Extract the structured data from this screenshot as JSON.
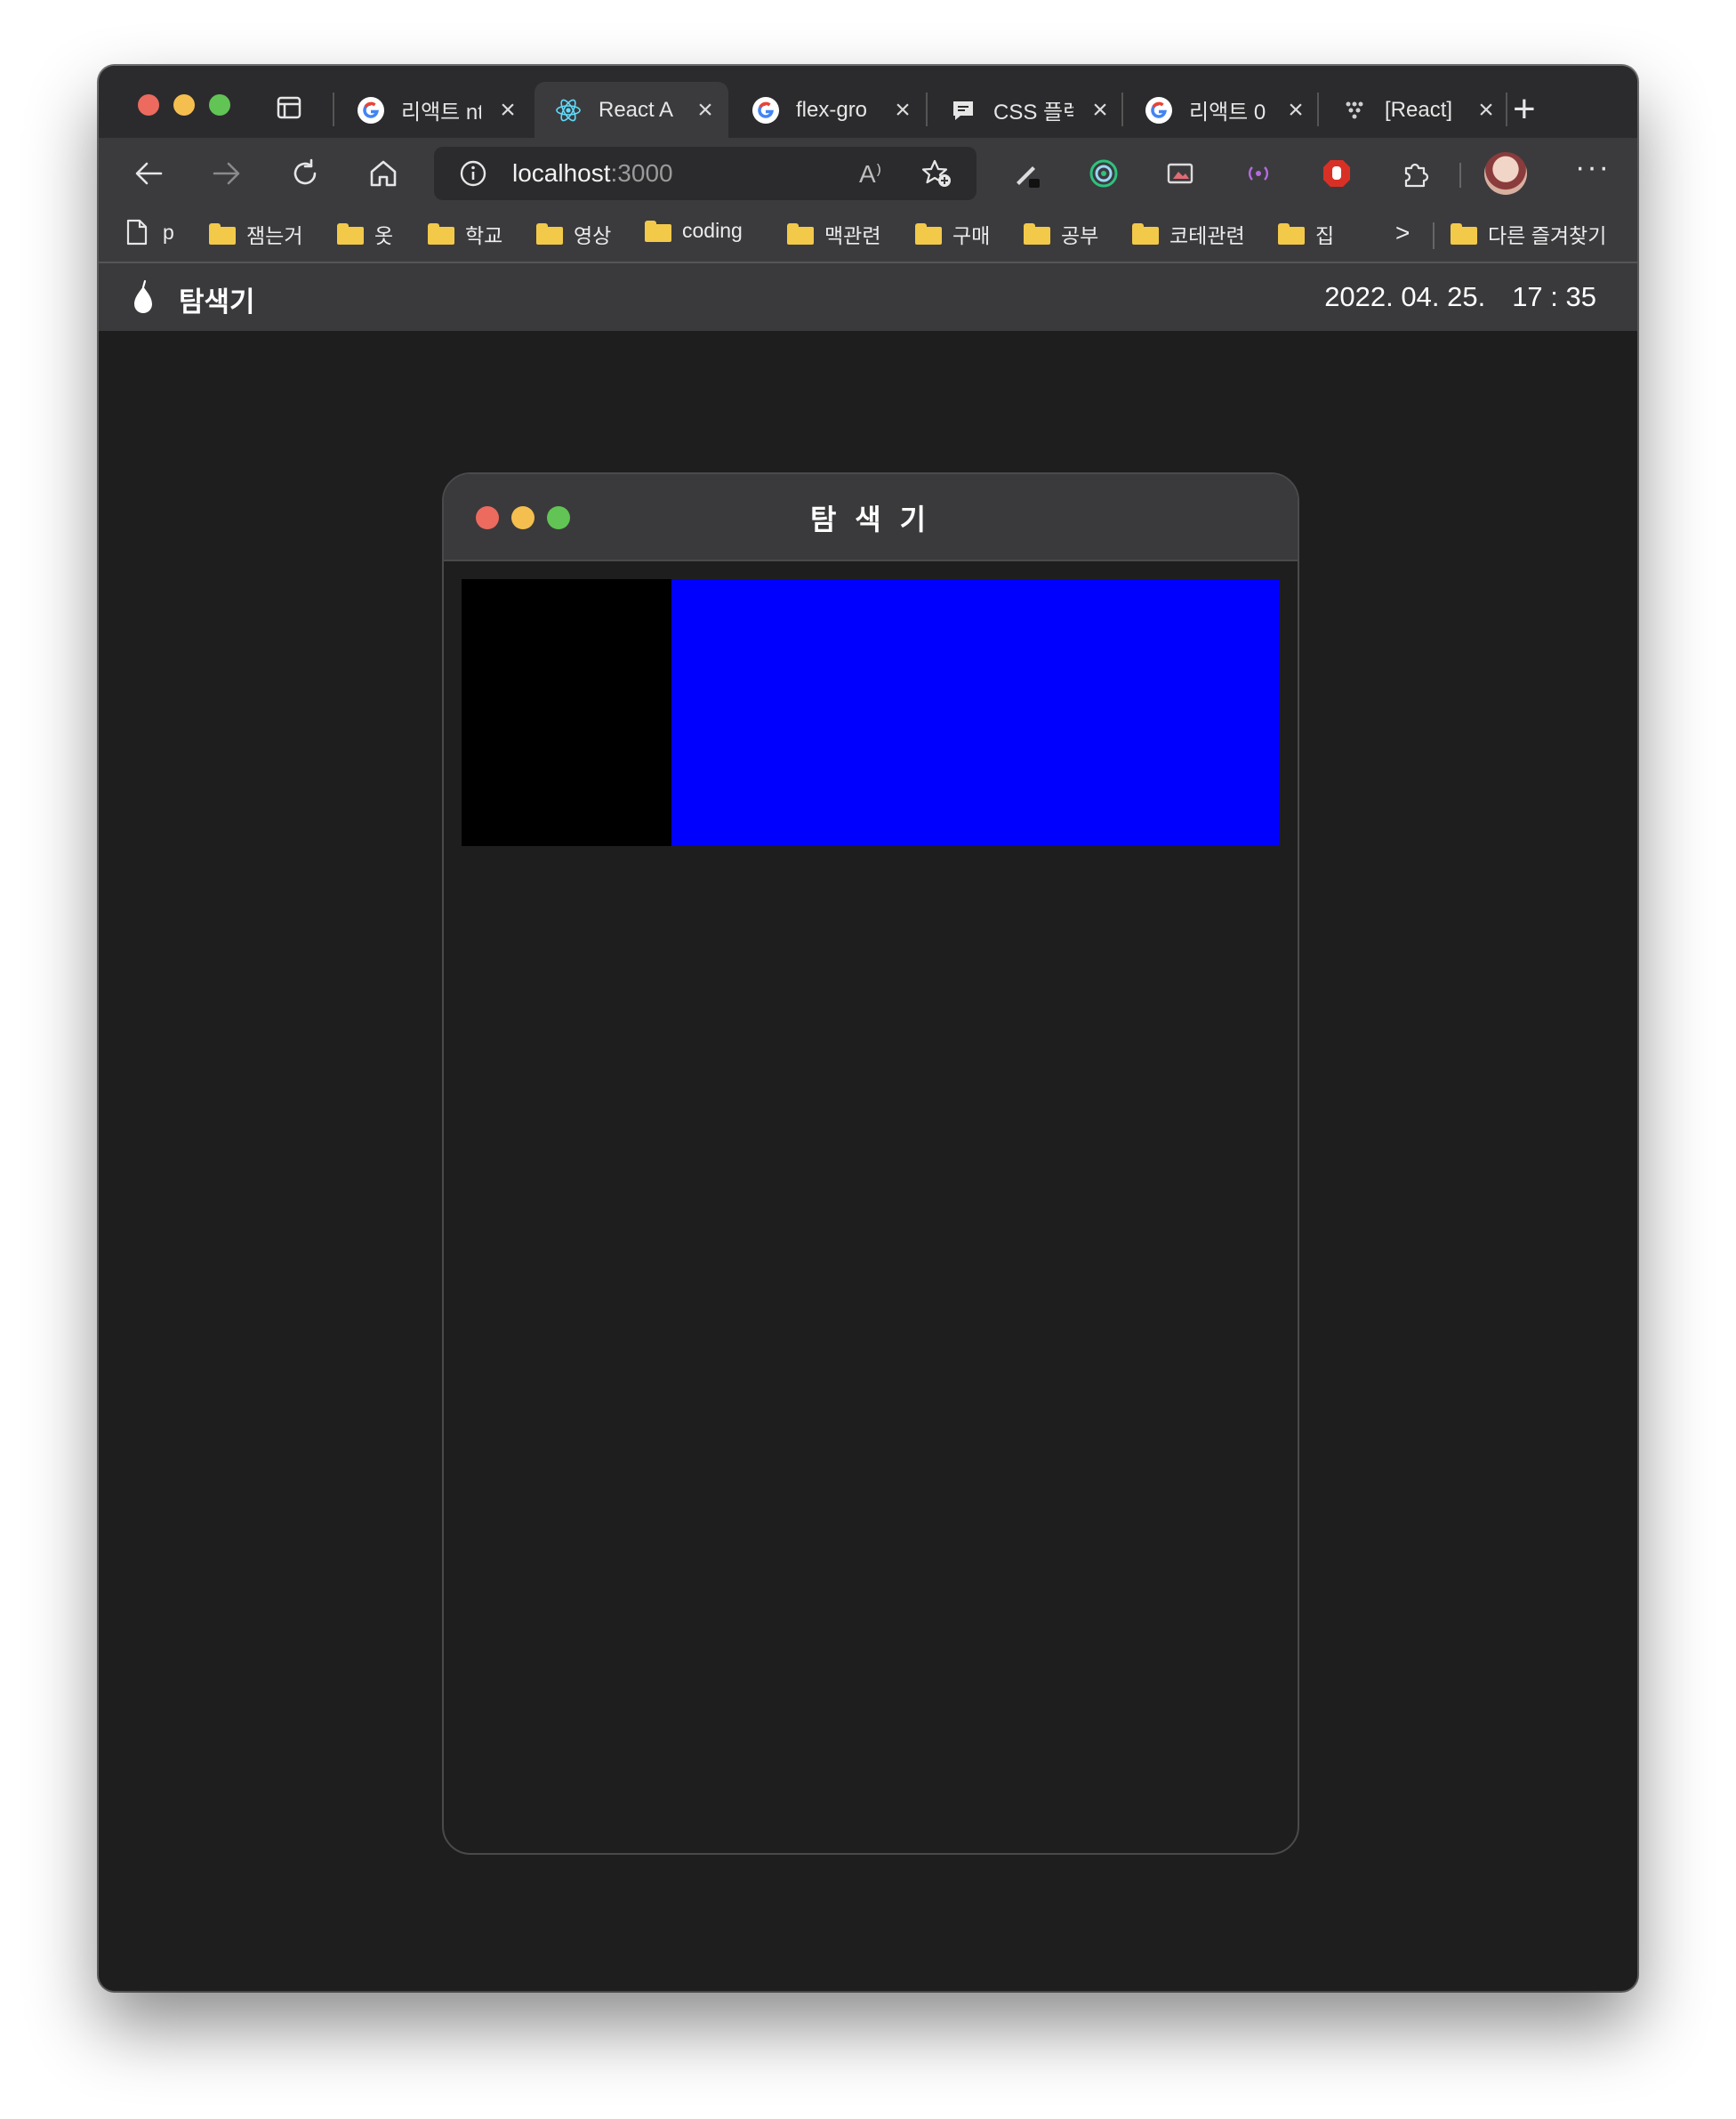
{
  "browser": {
    "tabs": [
      {
        "title": "리액트 nt",
        "favicon": "google-g-icon",
        "active": false
      },
      {
        "title": "React A",
        "favicon": "react-atom-icon",
        "active": true
      },
      {
        "title": "flex-gro",
        "favicon": "google-g-icon",
        "active": false
      },
      {
        "title": "CSS 플렉",
        "favicon": "chat-bubble-icon",
        "active": false
      },
      {
        "title": "리액트 0",
        "favicon": "google-g-icon",
        "active": false
      },
      {
        "title": "[React]",
        "favicon": "dots-icon",
        "active": false
      }
    ],
    "close_glyph": "×",
    "new_tab_glyph": "+",
    "address": {
      "host": "localhost",
      "port": ":3000"
    },
    "read_aloud_glyph": "A⁾",
    "more_glyph": "···",
    "bookmarks": [
      {
        "label": "p",
        "icon": "page-icon"
      },
      {
        "label": "잼는거",
        "icon": "folder-icon"
      },
      {
        "label": "옷",
        "icon": "folder-icon"
      },
      {
        "label": "학교",
        "icon": "folder-icon"
      },
      {
        "label": "영상",
        "icon": "folder-icon"
      },
      {
        "label": "coding",
        "icon": "folder-icon"
      },
      {
        "label": "맥관련",
        "icon": "folder-icon"
      },
      {
        "label": "구매",
        "icon": "folder-icon"
      },
      {
        "label": "공부",
        "icon": "folder-icon"
      },
      {
        "label": "코테관련",
        "icon": "folder-icon"
      },
      {
        "label": "집",
        "icon": "folder-icon"
      }
    ],
    "bookmarks_overflow_glyph": ">",
    "other_favorites": "다른 즐겨찾기"
  },
  "app": {
    "title": "탐색기",
    "date": "2022. 04. 25.",
    "time": "17 : 35"
  },
  "window": {
    "title": "탐 색 기",
    "panels": [
      {
        "name": "left-panel",
        "color": "#000000"
      },
      {
        "name": "right-panel",
        "color": "#0000ff"
      }
    ]
  },
  "colors": {
    "page_bg": "#1f1e1f",
    "bar_bg": "#3a3a3c",
    "traffic_red": "#ed6a5e",
    "traffic_yellow": "#f5bf4f",
    "traffic_green": "#61c454"
  }
}
